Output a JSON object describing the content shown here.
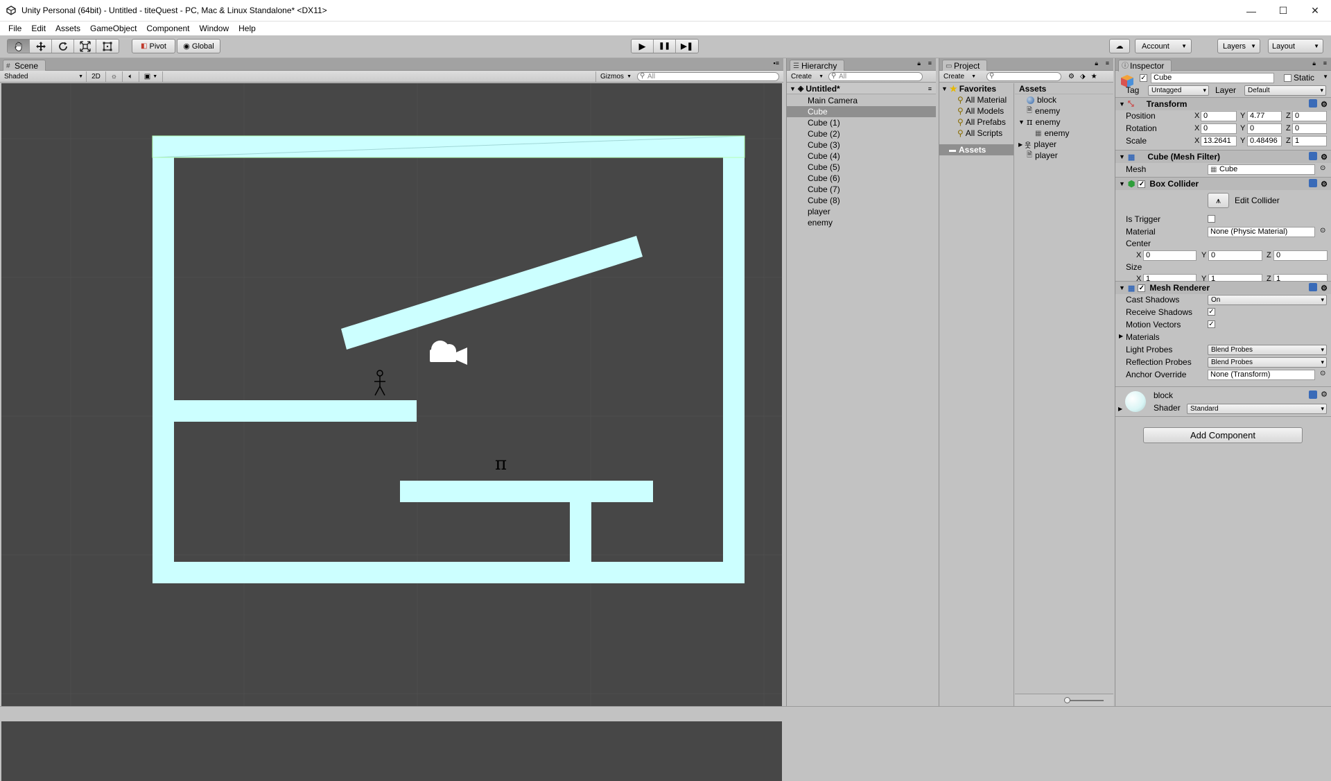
{
  "window": {
    "title": "Unity Personal (64bit) - Untitled - titeQuest - PC, Mac & Linux Standalone* <DX11>",
    "minimize": "—",
    "maximize": "☐",
    "close": "✕"
  },
  "menu": [
    "File",
    "Edit",
    "Assets",
    "GameObject",
    "Component",
    "Window",
    "Help"
  ],
  "toolbar": {
    "pivot": "Pivot",
    "global": "Global",
    "play": "▶",
    "pause": "❚❚",
    "step": "▶❚",
    "account": "Account",
    "layers": "Layers",
    "layout": "Layout"
  },
  "scene": {
    "tab": "Scene",
    "shading": "Shaded",
    "mode2d": "2D",
    "gizmos": "Gizmos",
    "search_placeholder": "All",
    "background_color": "#474747",
    "block_color": "#ccffff"
  },
  "hierarchy": {
    "tab": "Hierarchy",
    "create": "Create",
    "search_placeholder": "All",
    "scene_name": "Untitled*",
    "items": [
      "Main Camera",
      "Cube",
      "Cube (1)",
      "Cube (2)",
      "Cube (3)",
      "Cube (4)",
      "Cube (5)",
      "Cube (6)",
      "Cube (7)",
      "Cube (8)",
      "player",
      "enemy"
    ],
    "selected": "Cube"
  },
  "project": {
    "tab": "Project",
    "create": "Create",
    "favorites_label": "Favorites",
    "favorites": [
      "All Material",
      "All Models",
      "All Prefabs",
      "All Scripts"
    ],
    "assets_folder": "Assets",
    "assets_header": "Assets",
    "assets": [
      {
        "name": "block",
        "icon": "material-sphere-icon",
        "indent": 0
      },
      {
        "name": "enemy",
        "icon": "script-icon",
        "indent": 0
      },
      {
        "name": "enemy",
        "icon": "pi-prefab-icon",
        "indent": 0,
        "expanded": true
      },
      {
        "name": "enemy",
        "icon": "mesh-icon",
        "indent": 1
      },
      {
        "name": "player",
        "icon": "stick-figure-icon",
        "indent": 0,
        "collapsed": true
      },
      {
        "name": "player",
        "icon": "script-icon",
        "indent": 0
      }
    ]
  },
  "inspector": {
    "tab": "Inspector",
    "object_name": "Cube",
    "static_label": "Static",
    "tag_label": "Tag",
    "tag_value": "Untagged",
    "layer_label": "Layer",
    "layer_value": "Default",
    "transform": {
      "title": "Transform",
      "position_label": "Position",
      "rotation_label": "Rotation",
      "scale_label": "Scale",
      "position": [
        "0",
        "4.77",
        "0"
      ],
      "rotation": [
        "0",
        "0",
        "0"
      ],
      "scale": [
        "13.2641",
        "0.48496",
        "1"
      ]
    },
    "mesh_filter": {
      "title": "Cube (Mesh Filter)",
      "mesh_label": "Mesh",
      "mesh_value": "Cube"
    },
    "box_collider": {
      "title": "Box Collider",
      "edit_collider": "Edit Collider",
      "is_trigger_label": "Is Trigger",
      "material_label": "Material",
      "material_value": "None (Physic Material)",
      "center_label": "Center",
      "center": [
        "0",
        "0",
        "0"
      ],
      "size_label": "Size",
      "size": [
        "1",
        "1",
        "1"
      ]
    },
    "mesh_renderer": {
      "title": "Mesh Renderer",
      "cast_shadows_label": "Cast Shadows",
      "cast_shadows_value": "On",
      "receive_shadows_label": "Receive Shadows",
      "motion_vectors_label": "Motion Vectors",
      "materials_label": "Materials",
      "light_probes_label": "Light Probes",
      "light_probes_value": "Blend Probes",
      "reflection_probes_label": "Reflection Probes",
      "reflection_probes_value": "Blend Probes",
      "anchor_override_label": "Anchor Override",
      "anchor_override_value": "None (Transform)"
    },
    "material": {
      "name": "block",
      "shader_label": "Shader",
      "shader_value": "Standard"
    },
    "add_component": "Add Component",
    "axis": [
      "X",
      "Y",
      "Z"
    ]
  }
}
